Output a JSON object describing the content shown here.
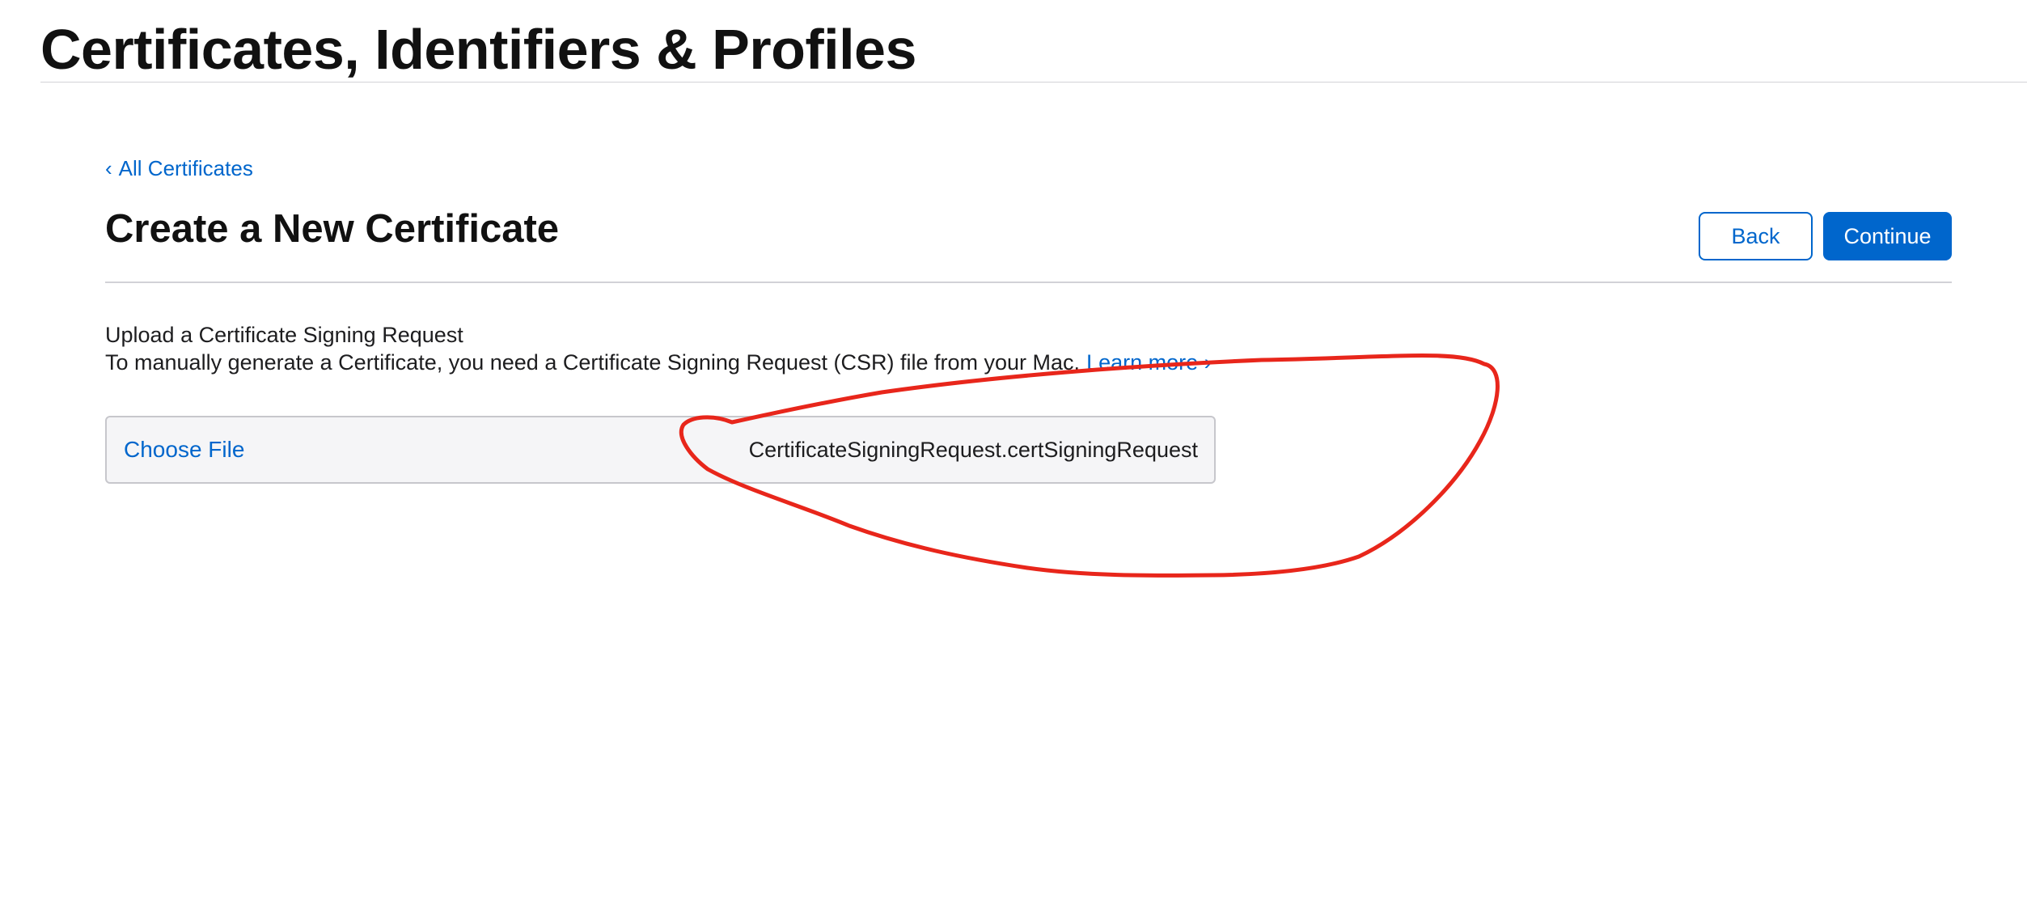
{
  "header": {
    "title": "Certificates, Identifiers & Profiles"
  },
  "breadcrumb": {
    "chevron": "‹",
    "label": "All Certificates"
  },
  "page": {
    "heading": "Create a New Certificate"
  },
  "actions": {
    "back_label": "Back",
    "continue_label": "Continue"
  },
  "upload": {
    "title": "Upload a Certificate Signing Request",
    "description": "To manually generate a Certificate, you need a Certificate Signing Request (CSR) file from your Mac.",
    "learn_more": "Learn more ›",
    "choose_file_label": "Choose File",
    "selected_file": "CertificateSigningRequest.certSigningRequest"
  },
  "colors": {
    "accent": "#0066cc",
    "annotation": "#e8261b",
    "divider": "#d2d2d7",
    "field_background": "#f5f5f7"
  }
}
